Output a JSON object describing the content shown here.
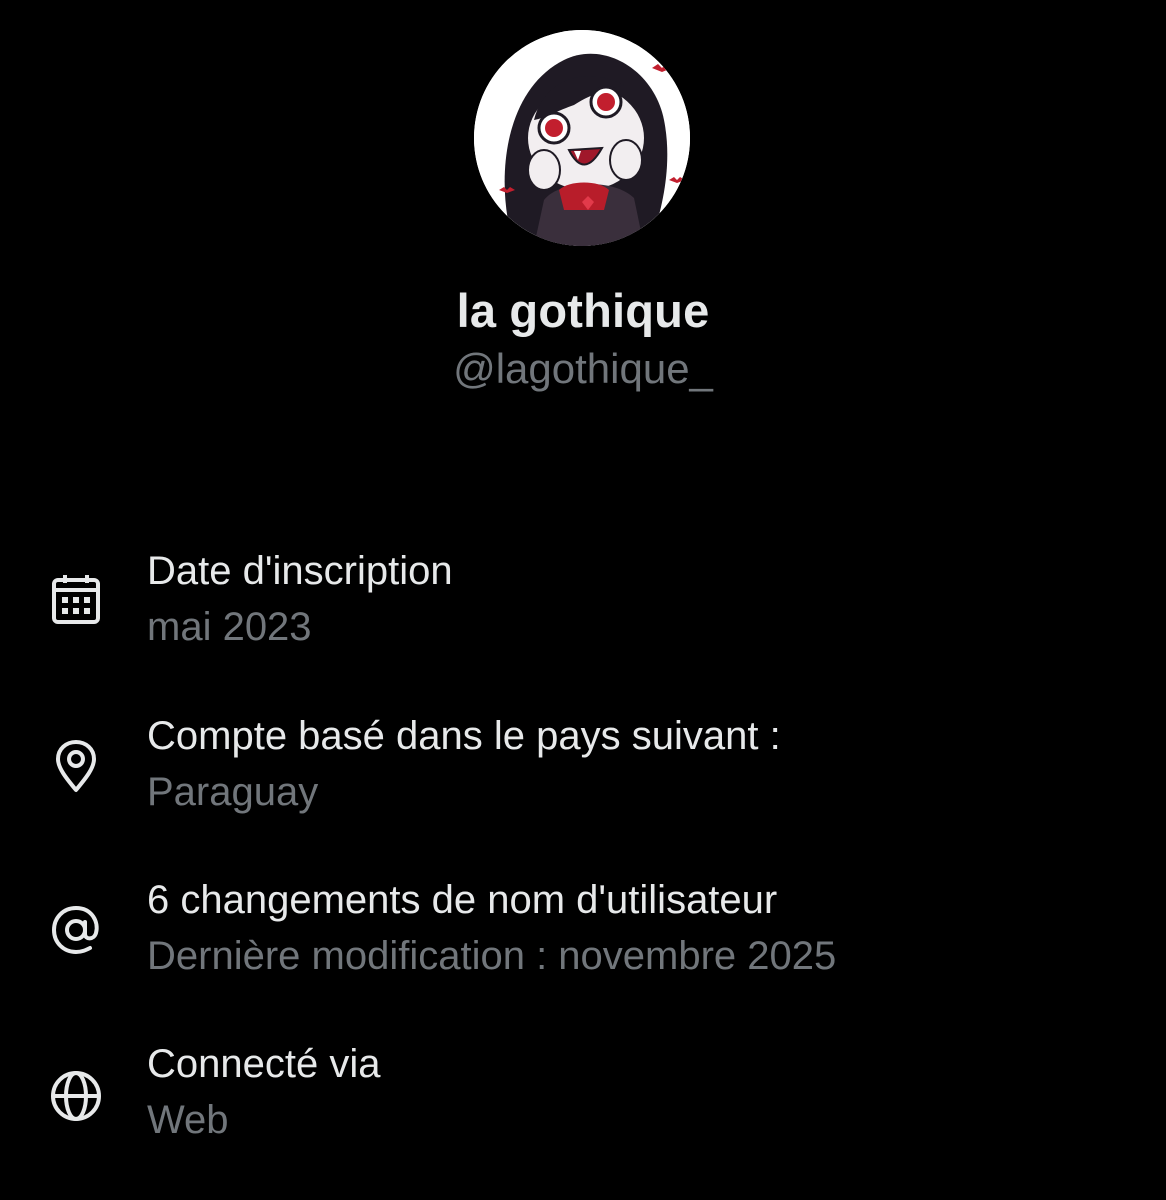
{
  "profile": {
    "display_name": "la gothique",
    "handle": "@lagothique_"
  },
  "about": {
    "items": [
      {
        "icon": "calendar-icon",
        "label": "Date d'inscription",
        "value": "mai 2023"
      },
      {
        "icon": "location-pin-icon",
        "label": "Compte basé dans le pays suivant :",
        "value": "Paraguay"
      },
      {
        "icon": "at-sign-icon",
        "label": "6 changements de nom d'utilisateur",
        "value": "Dernière modification : novembre 2025"
      },
      {
        "icon": "globe-icon",
        "label": "Connecté via",
        "value": "Web"
      }
    ]
  },
  "colors": {
    "background": "#000000",
    "primary_text": "#e7e9ea",
    "secondary_text": "#71767b"
  }
}
